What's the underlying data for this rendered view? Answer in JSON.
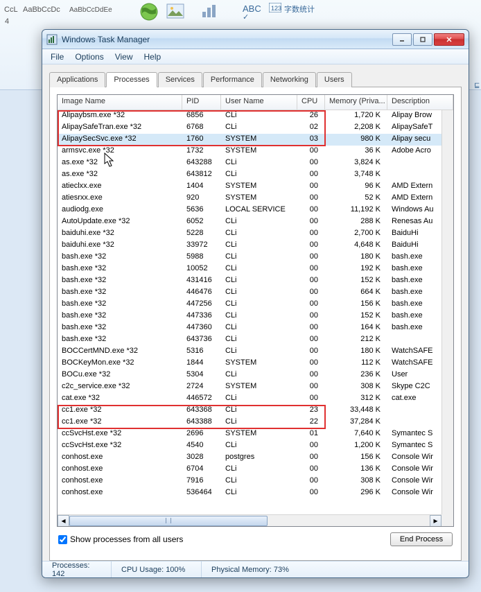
{
  "ribbon": {
    "style1": "CcL",
    "style2": "AaBbCcDc",
    "style3": "AaBbCcDdEe",
    "num": "4",
    "wordcount": "字数统计"
  },
  "window": {
    "title": "Windows Task Manager"
  },
  "menu": {
    "file": "File",
    "options": "Options",
    "view": "View",
    "help": "Help"
  },
  "tabs": {
    "applications": "Applications",
    "processes": "Processes",
    "services": "Services",
    "performance": "Performance",
    "networking": "Networking",
    "users": "Users"
  },
  "columns": {
    "image_name": "Image Name",
    "pid": "PID",
    "user_name": "User Name",
    "cpu": "CPU",
    "memory": "Memory (Priva...",
    "description": "Description"
  },
  "processes": [
    {
      "name": "Alipaybsm.exe *32",
      "pid": "6856",
      "user": "CLi",
      "cpu": "26",
      "mem": "1,720 K",
      "desc": "Alipay Brow"
    },
    {
      "name": "AlipaySafeTran.exe *32",
      "pid": "6768",
      "user": "CLi",
      "cpu": "02",
      "mem": "2,208 K",
      "desc": "AlipaySafeT"
    },
    {
      "name": "AlipaySecSvc.exe *32",
      "pid": "1760",
      "user": "SYSTEM",
      "cpu": "03",
      "mem": "980 K",
      "desc": "Alipay secu"
    },
    {
      "name": "armsvc.exe *32",
      "pid": "1732",
      "user": "SYSTEM",
      "cpu": "00",
      "mem": "36 K",
      "desc": "Adobe Acro"
    },
    {
      "name": "as.exe *32",
      "pid": "643288",
      "user": "CLi",
      "cpu": "00",
      "mem": "3,824 K",
      "desc": ""
    },
    {
      "name": "as.exe *32",
      "pid": "643812",
      "user": "CLi",
      "cpu": "00",
      "mem": "3,748 K",
      "desc": ""
    },
    {
      "name": "atieclxx.exe",
      "pid": "1404",
      "user": "SYSTEM",
      "cpu": "00",
      "mem": "96 K",
      "desc": "AMD Extern"
    },
    {
      "name": "atiesrxx.exe",
      "pid": "920",
      "user": "SYSTEM",
      "cpu": "00",
      "mem": "52 K",
      "desc": "AMD Extern"
    },
    {
      "name": "audiodg.exe",
      "pid": "5636",
      "user": "LOCAL SERVICE",
      "cpu": "00",
      "mem": "11,192 K",
      "desc": "Windows Au"
    },
    {
      "name": "AutoUpdate.exe *32",
      "pid": "6052",
      "user": "CLi",
      "cpu": "00",
      "mem": "288 K",
      "desc": "Renesas Au"
    },
    {
      "name": "baiduhi.exe *32",
      "pid": "5228",
      "user": "CLi",
      "cpu": "00",
      "mem": "2,700 K",
      "desc": "BaiduHi"
    },
    {
      "name": "baiduhi.exe *32",
      "pid": "33972",
      "user": "CLi",
      "cpu": "00",
      "mem": "4,648 K",
      "desc": "BaiduHi"
    },
    {
      "name": "bash.exe *32",
      "pid": "5988",
      "user": "CLi",
      "cpu": "00",
      "mem": "180 K",
      "desc": "bash.exe"
    },
    {
      "name": "bash.exe *32",
      "pid": "10052",
      "user": "CLi",
      "cpu": "00",
      "mem": "192 K",
      "desc": "bash.exe"
    },
    {
      "name": "bash.exe *32",
      "pid": "431416",
      "user": "CLi",
      "cpu": "00",
      "mem": "152 K",
      "desc": "bash.exe"
    },
    {
      "name": "bash.exe *32",
      "pid": "446476",
      "user": "CLi",
      "cpu": "00",
      "mem": "664 K",
      "desc": "bash.exe"
    },
    {
      "name": "bash.exe *32",
      "pid": "447256",
      "user": "CLi",
      "cpu": "00",
      "mem": "156 K",
      "desc": "bash.exe"
    },
    {
      "name": "bash.exe *32",
      "pid": "447336",
      "user": "CLi",
      "cpu": "00",
      "mem": "152 K",
      "desc": "bash.exe"
    },
    {
      "name": "bash.exe *32",
      "pid": "447360",
      "user": "CLi",
      "cpu": "00",
      "mem": "164 K",
      "desc": "bash.exe"
    },
    {
      "name": "bash.exe *32",
      "pid": "643736",
      "user": "CLi",
      "cpu": "00",
      "mem": "212 K",
      "desc": ""
    },
    {
      "name": "BOCCertMND.exe *32",
      "pid": "5316",
      "user": "CLi",
      "cpu": "00",
      "mem": "180 K",
      "desc": "WatchSAFE"
    },
    {
      "name": "BOCKeyMon.exe *32",
      "pid": "1844",
      "user": "SYSTEM",
      "cpu": "00",
      "mem": "112 K",
      "desc": "WatchSAFE"
    },
    {
      "name": "BOCu.exe *32",
      "pid": "5304",
      "user": "CLi",
      "cpu": "00",
      "mem": "236 K",
      "desc": "User"
    },
    {
      "name": "c2c_service.exe *32",
      "pid": "2724",
      "user": "SYSTEM",
      "cpu": "00",
      "mem": "308 K",
      "desc": "Skype C2C"
    },
    {
      "name": "cat.exe *32",
      "pid": "446572",
      "user": "CLi",
      "cpu": "00",
      "mem": "312 K",
      "desc": "cat.exe"
    },
    {
      "name": "cc1.exe *32",
      "pid": "643368",
      "user": "CLi",
      "cpu": "23",
      "mem": "33,448 K",
      "desc": ""
    },
    {
      "name": "cc1.exe *32",
      "pid": "643388",
      "user": "CLi",
      "cpu": "22",
      "mem": "37,284 K",
      "desc": ""
    },
    {
      "name": "ccSvcHst.exe *32",
      "pid": "2696",
      "user": "SYSTEM",
      "cpu": "01",
      "mem": "7,640 K",
      "desc": "Symantec S"
    },
    {
      "name": "ccSvcHst.exe *32",
      "pid": "4540",
      "user": "CLi",
      "cpu": "00",
      "mem": "1,200 K",
      "desc": "Symantec S"
    },
    {
      "name": "conhost.exe",
      "pid": "3028",
      "user": "postgres",
      "cpu": "00",
      "mem": "156 K",
      "desc": "Console Wir"
    },
    {
      "name": "conhost.exe",
      "pid": "6704",
      "user": "CLi",
      "cpu": "00",
      "mem": "136 K",
      "desc": "Console Wir"
    },
    {
      "name": "conhost.exe",
      "pid": "7916",
      "user": "CLi",
      "cpu": "00",
      "mem": "308 K",
      "desc": "Console Wir"
    },
    {
      "name": "conhost.exe",
      "pid": "536464",
      "user": "CLi",
      "cpu": "00",
      "mem": "296 K",
      "desc": "Console Wir"
    }
  ],
  "checkbox_label": "Show processes from all users",
  "end_process_btn": "End Process",
  "status": {
    "processes": "Processes: 142",
    "cpu": "CPU Usage: 100%",
    "memory": "Physical Memory: 73%"
  }
}
